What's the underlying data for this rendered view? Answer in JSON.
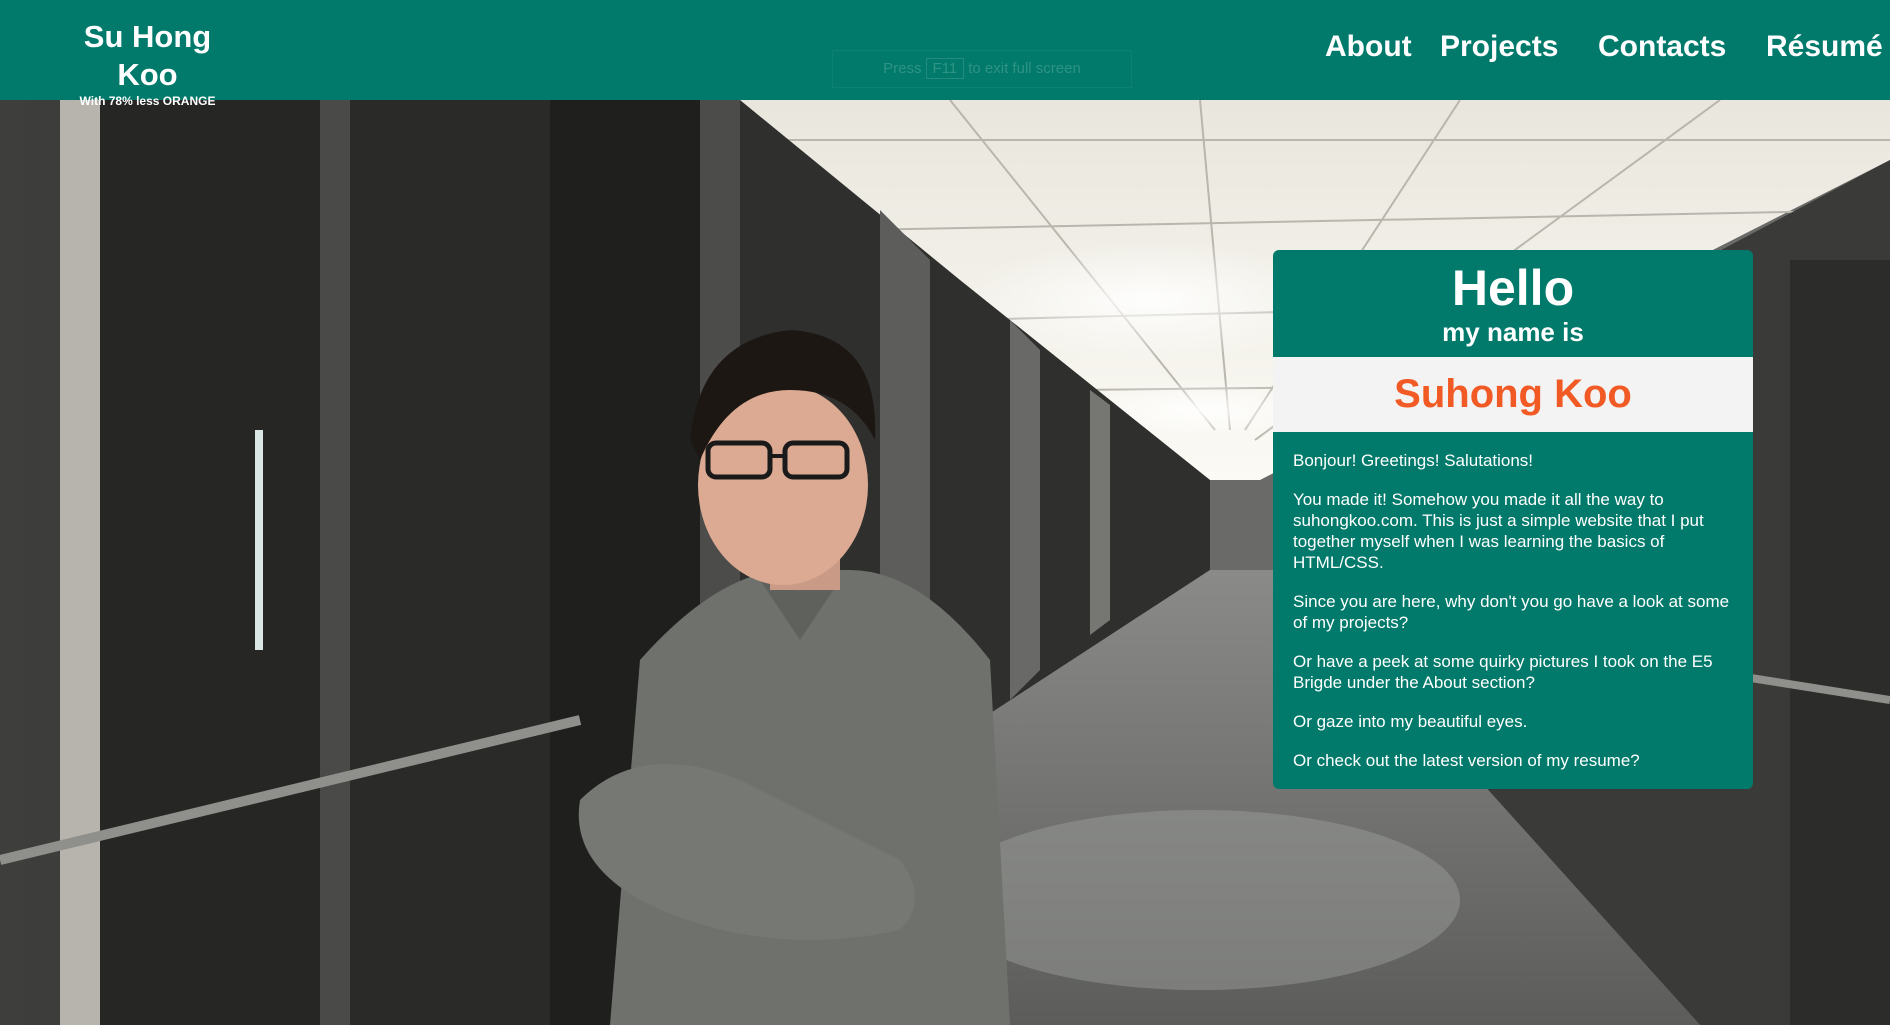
{
  "header": {
    "brand_title": "Su Hong Koo",
    "brand_subtitle": "With 78% less ORANGE",
    "nav": [
      {
        "label": "About"
      },
      {
        "label": "Projects"
      },
      {
        "label": "Contacts"
      },
      {
        "label": "Résumé"
      }
    ],
    "fullscreen_hint": {
      "prefix": "Press",
      "key": "F11",
      "suffix": "to exit full screen"
    }
  },
  "card": {
    "hello": "Hello",
    "my_name_is": "my name is",
    "name": "Suhong Koo",
    "paragraphs": [
      "Bonjour! Greetings! Salutations!",
      "You made it! Somehow you made it all the way to suhongkoo.com. This is just a simple website that I put together myself when I was learning the basics of HTML/CSS.",
      "Since you are here, why don't you go have a look at some of my projects?",
      "Or have a peek at some quirky pictures I took on the E5 Brigde under the About section?",
      "Or gaze into my beautiful eyes.",
      "Or check out the latest version of my resume?"
    ]
  },
  "colors": {
    "header_bg": "#017a6b",
    "card_bg": "#017a6b",
    "name_color": "#f15a24",
    "name_box_bg": "#f3f3f3"
  }
}
